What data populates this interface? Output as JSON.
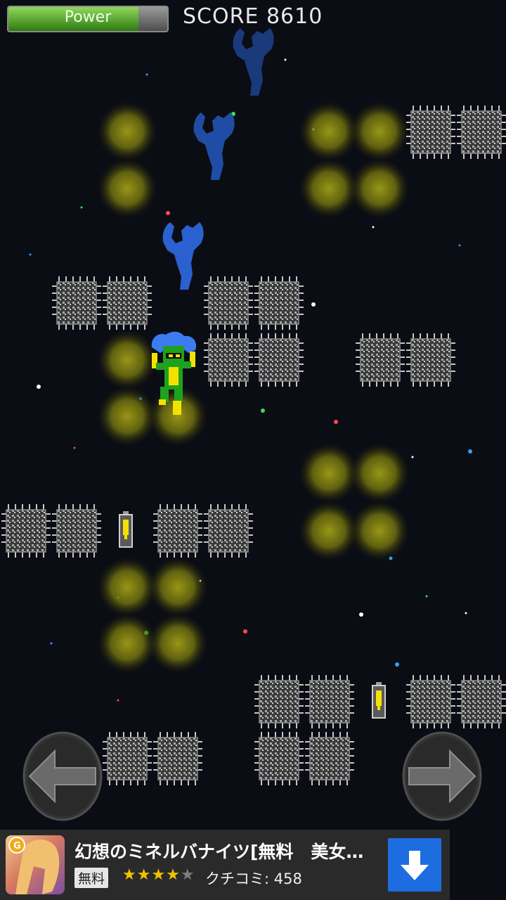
{
  "hud": {
    "power_label": "Power",
    "power_level": 0.82,
    "score_text": "SCORE 8610"
  },
  "colors": {
    "background": "#0b0d14",
    "chip_dark": "#3d3d3d",
    "chip_light": "#bdbdbd",
    "glow": "#6b6b12",
    "diver_shadow_blue": "#1a3f86",
    "diver_blue": "#2e62d6",
    "player_green": "#1ea21e",
    "player_yellow": "#f3e200",
    "player_hair": "#3c7cf0",
    "button_fill": "#3a3a3a",
    "ad_download": "#1d6de0"
  },
  "icons": {
    "left": "arrow-left-icon",
    "right": "arrow-right-icon",
    "download": "download-arrow-icon",
    "battery": "battery-icon"
  },
  "ad": {
    "title": "幻想のミネルバナイツ[無料　美女…",
    "badge": "無料",
    "rating": 4,
    "rating_max": 5,
    "stars_on": "★★★★",
    "stars_off": "★",
    "reviews": "クチコミ: 458"
  }
}
